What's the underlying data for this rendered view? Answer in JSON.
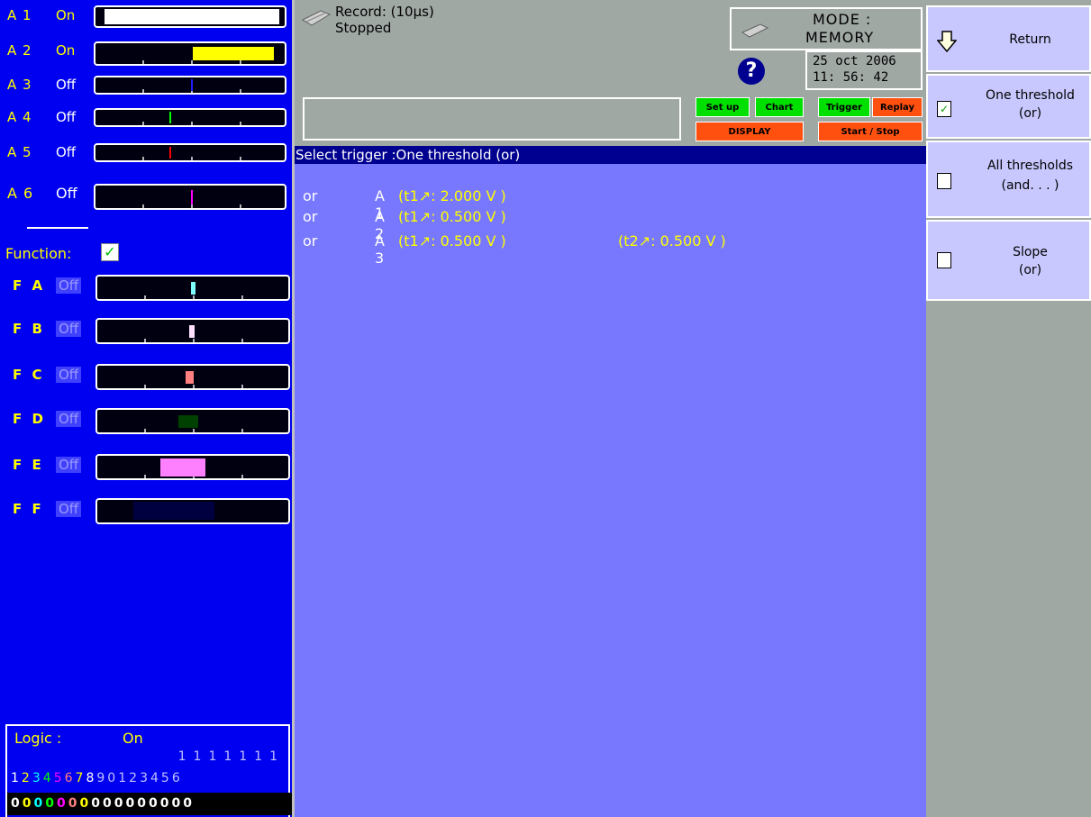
{
  "analog_channels": [
    {
      "name": "A 1",
      "state": "On",
      "marker_color": "#ffffff"
    },
    {
      "name": "A 2",
      "state": "On",
      "marker_color": "#ffff00"
    },
    {
      "name": "A 3",
      "state": "Off",
      "marker_color": "#0000ff"
    },
    {
      "name": "A 4",
      "state": "Off",
      "marker_color": "#00ff00"
    },
    {
      "name": "A 5",
      "state": "Off",
      "marker_color": "#ff0000"
    },
    {
      "name": "A 6",
      "state": "Off",
      "marker_color": "#ff00ff"
    }
  ],
  "function": {
    "label": "Function:",
    "checked": true,
    "check_glyph": "✓"
  },
  "function_channels": [
    {
      "name": "F A",
      "state": "Off",
      "marker_color": "#80ffff"
    },
    {
      "name": "F B",
      "state": "Off",
      "marker_color": "#ffe0ff"
    },
    {
      "name": "F C",
      "state": "Off",
      "marker_color": "#ff8080"
    },
    {
      "name": "F D",
      "state": "Off",
      "marker_color": "#004000"
    },
    {
      "name": "F E",
      "state": "Off",
      "marker_color": "#ff80ff"
    },
    {
      "name": "F F",
      "state": "Off",
      "marker_color": "#000040"
    }
  ],
  "logic": {
    "label": "Logic :",
    "state": "On",
    "tens": "1111111",
    "numbers": "1234567890123456",
    "bits": "0000000000000000",
    "number_colors": [
      "#ffffff",
      "#ffff00",
      "#00ffff",
      "#00ff00",
      "#ff00ff",
      "#ff8080",
      "#ffff00",
      "#ffffff",
      "#c0c0ff",
      "#c0c0ff",
      "#c0c0ff",
      "#c0c0ff",
      "#c0c0ff",
      "#c0c0ff",
      "#c0c0ff",
      "#c0c0ff"
    ],
    "bit_colors": [
      "#ffffff",
      "#ffff00",
      "#00ffff",
      "#00ff00",
      "#ff00ff",
      "#ff8080",
      "#ffff00",
      "#ffffff",
      "#ffffff",
      "#ffffff",
      "#ffffff",
      "#ffffff",
      "#ffffff",
      "#ffffff",
      "#ffffff",
      "#ffffff"
    ]
  },
  "header": {
    "record_line1": "Record: (10µs)",
    "record_line2": "Stopped",
    "mode_line1": "MODE :",
    "mode_line2": "MEMORY",
    "help_glyph": "?",
    "date": "25 oct 2006",
    "time": "11: 56: 42",
    "buttons": {
      "setup": "Set up",
      "chart": "Chart",
      "trigger": "Trigger",
      "replay": "Replay",
      "display": "DISPLAY",
      "start_stop": "Start / Stop"
    }
  },
  "status_text": "Select trigger :One threshold (or)",
  "trigger_rows": [
    {
      "op": "or",
      "channel": "A 1",
      "value1": "(t1↗: 2.000 V )",
      "value2": ""
    },
    {
      "op": "or",
      "channel": "A 2",
      "value1": "(t1↗: 0.500 V )",
      "value2": ""
    },
    {
      "op": "or",
      "channel": "A 3",
      "value1": "(t1↗: 0.500 V )",
      "value2": "(t2↗: 0.500 V )"
    }
  ],
  "menu": {
    "return_label": "Return",
    "items": [
      {
        "line1": "One threshold",
        "line2": "(or)",
        "checked": true,
        "check_glyph": "✓"
      },
      {
        "line1": "All thresholds",
        "line2": "(and. . . )",
        "checked": false,
        "check_glyph": ""
      },
      {
        "line1": "Slope",
        "line2": "(or)",
        "checked": false,
        "check_glyph": ""
      }
    ]
  },
  "colors": {
    "panel_blue": "#0000f0",
    "content_blue": "#7878ff",
    "status_navy": "#000090",
    "header_gray": "#a0a8a4",
    "button_green": "#00e000",
    "button_orange": "#ff5010",
    "menu_lavender": "#c8c8ff",
    "label_yellow": "#ffff00"
  }
}
